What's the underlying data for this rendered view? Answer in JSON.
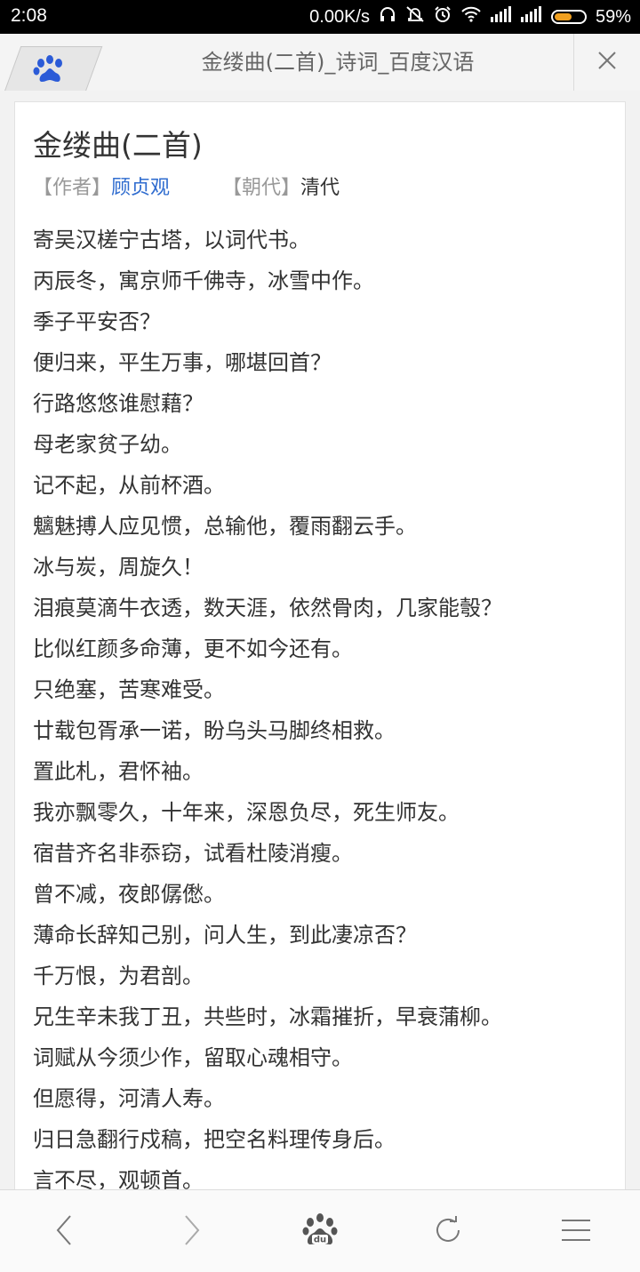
{
  "status_bar": {
    "time": "2:08",
    "network_speed": "0.00K/s",
    "battery_percent": "59%",
    "battery_level": 0.59,
    "icons": [
      "headphones-icon",
      "mute-icon",
      "alarm-icon",
      "wifi-icon",
      "signal-icon",
      "signal-icon",
      "battery-icon"
    ]
  },
  "tab": {
    "title": "金缕曲(二首)_诗词_百度汉语",
    "favicon": "baidu-paw-icon",
    "close_icon": "close-icon"
  },
  "poem": {
    "title": "金缕曲(二首)",
    "author_label": "【作者】",
    "author": "顾贞观",
    "dynasty_label": "【朝代】",
    "dynasty": "清代",
    "lines": [
      "寄吴汉槎宁古塔，以词代书。",
      "丙辰冬，寓京师千佛寺，冰雪中作。",
      "季子平安否？",
      "便归来，平生万事，哪堪回首？",
      "行路悠悠谁慰藉？",
      "母老家贫子幼。",
      "记不起，从前杯酒。",
      "魑魅搏人应见惯，总输他，覆雨翻云手。",
      "冰与炭，周旋久！",
      "泪痕莫滴牛衣透，数天涯，依然骨肉，几家能彀？",
      "比似红颜多命薄，更不如今还有。",
      "只绝塞，苦寒难受。",
      "廿载包胥承一诺，盼乌头马脚终相救。",
      "置此札，君怀袖。",
      "我亦飘零久，十年来，深恩负尽，死生师友。",
      "宿昔齐名非忝窃，试看杜陵消瘦。",
      "曾不减，夜郎僝僽。",
      "薄命长辞知己别，问人生，到此凄凉否？",
      "千万恨，为君剖。",
      "兄生辛未我丁丑，共些时，冰霜摧折，早衰蒲柳。",
      "词赋从今须少作，留取心魂相守。",
      "但愿得，河清人寿。",
      "归日急翻行戍稿，把空名料理传身后。",
      "言不尽，观顿首。"
    ]
  },
  "bottom_nav": {
    "items": [
      "back-icon",
      "forward-icon",
      "baidu-home-icon",
      "refresh-icon",
      "menu-icon"
    ]
  },
  "colors": {
    "author_link": "#2f6ccf",
    "text": "#333333",
    "muted": "#999999",
    "baidu_blue": "#2b5bd7",
    "battery": "#f0a020"
  }
}
